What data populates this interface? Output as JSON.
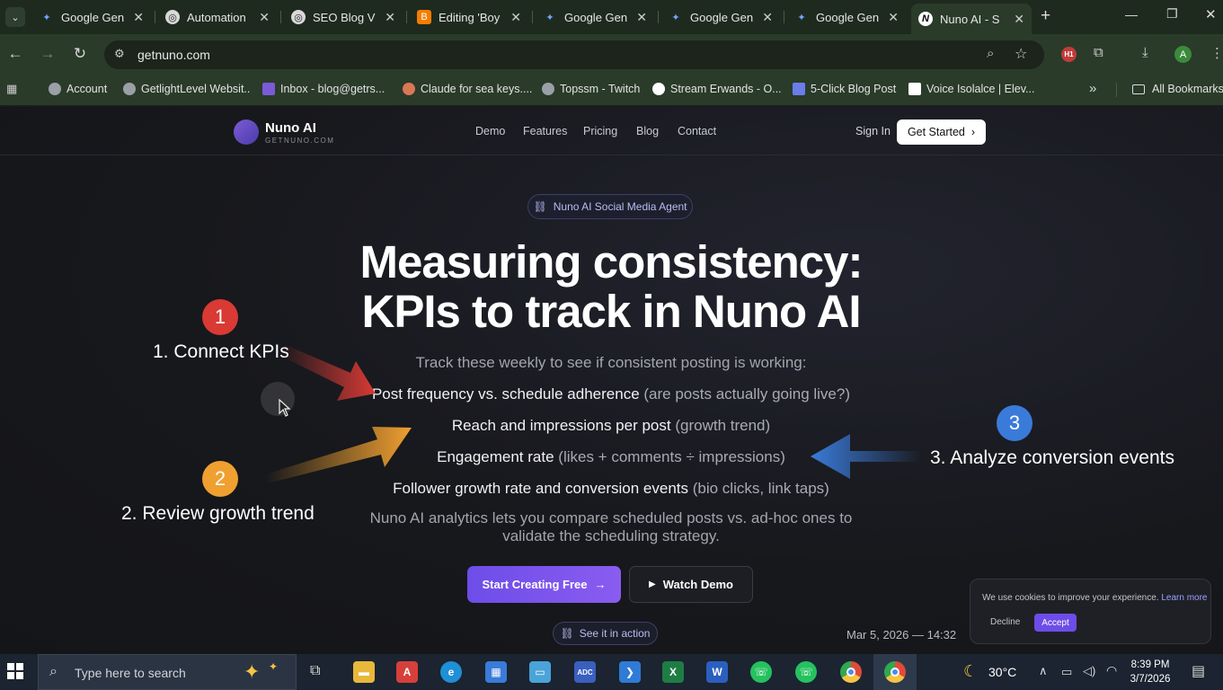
{
  "browser": {
    "tabs": [
      {
        "title": "Google Gen",
        "icon": "gemini-icon",
        "active": false
      },
      {
        "title": "Automation",
        "icon": "openai-icon",
        "active": false
      },
      {
        "title": "SEO Blog Vi",
        "icon": "openai-icon",
        "active": false
      },
      {
        "title": "Editing 'Boy",
        "icon": "blogger-icon",
        "active": false
      },
      {
        "title": "Google Gen",
        "icon": "gemini-icon",
        "active": false
      },
      {
        "title": "Google Gen",
        "icon": "gemini-icon",
        "active": false
      },
      {
        "title": "Google Gen",
        "icon": "gemini-icon",
        "active": false
      },
      {
        "title": "Nuno AI - S",
        "icon": "nuno-icon",
        "active": true
      }
    ],
    "new_tab": "+",
    "url": "getnuno.com",
    "profile_initial": "A",
    "bookmarks": [
      {
        "label": "Account",
        "color": "#9aa0a6"
      },
      {
        "label": "GetlightLevel Websit..",
        "color": "#9aa0a6"
      },
      {
        "label": "Inbox - blog@getrs...",
        "color": "#7b5ad8"
      },
      {
        "label": "Claude for sea keys....",
        "color": "#d97757"
      },
      {
        "label": "Topssm - Twitch",
        "color": "#9aa0a6"
      },
      {
        "label": "Stream Erwands - O...",
        "color": "#ffffff"
      },
      {
        "label": "5-Click Blog Post",
        "color": "#6a7de8"
      },
      {
        "label": "Voice Isolalce | Elev...",
        "color": "#ffffff"
      }
    ],
    "all_bookmarks": "All Bookmarks"
  },
  "site": {
    "logo_name": "Nuno AI",
    "logo_sub": "GETNUNO.COM",
    "nav": [
      "Demo",
      "Features",
      "Pricing",
      "Blog",
      "Contact"
    ],
    "sign_in": "Sign In",
    "get_started": "Get Started",
    "badge": "Nuno AI Social Media Agent",
    "headline_1": "Measuring consistency:",
    "headline_2": "KPIs to track in Nuno AI",
    "subline": "Track these weekly to see if consistent posting is working:",
    "kpis": [
      {
        "main": "Post frequency vs. schedule adherence",
        "muted": "(are posts actually going live?)"
      },
      {
        "main": "Reach and impressions per post",
        "muted": "(growth trend)"
      },
      {
        "main": "Engagement rate",
        "muted": "(likes + comments ÷ impressions)"
      },
      {
        "main": "Follower growth rate and conversion events",
        "muted": "(bio clicks, link taps)"
      }
    ],
    "footnote_1": "Nuno AI analytics lets you compare scheduled posts vs. ad-hoc ones to",
    "footnote_2": "validate the scheduling strategy.",
    "cta_primary": "Start Creating Free",
    "cta_secondary": "Watch Demo",
    "see_it": "See it in action",
    "timestamp": "Mar 5, 2026 — 14:32"
  },
  "annotations": [
    {
      "number": "1",
      "label": "1. Connect KPIs",
      "color": "#d93a34"
    },
    {
      "number": "2",
      "label": "2. Review growth trend",
      "color": "#f0a030"
    },
    {
      "number": "3",
      "label": "3. Analyze conversion events",
      "color": "#3a7bd9"
    }
  ],
  "cookie": {
    "text": "We use cookies to improve your experience.",
    "link": "Learn more",
    "decline": "Decline",
    "accept": "Accept"
  },
  "taskbar": {
    "search_placeholder": "Type here to search",
    "weather": "30°C",
    "time": "8:39 PM",
    "date": "3/7/2026"
  }
}
